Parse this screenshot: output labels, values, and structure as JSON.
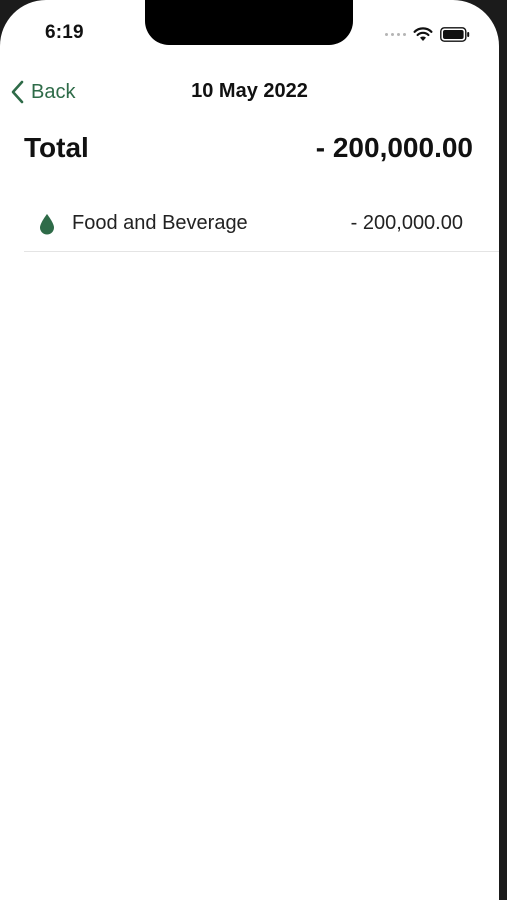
{
  "status_bar": {
    "time": "6:19"
  },
  "nav": {
    "back_label": "Back",
    "title": "10 May 2022"
  },
  "summary": {
    "total_label": "Total",
    "total_value": "- 200,000.00"
  },
  "categories": [
    {
      "icon": "drop-icon",
      "label": "Food and Beverage",
      "amount": "- 200,000.00"
    }
  ],
  "colors": {
    "accent": "#2e6b48",
    "text": "#111111",
    "divider": "#e4e4e4"
  }
}
